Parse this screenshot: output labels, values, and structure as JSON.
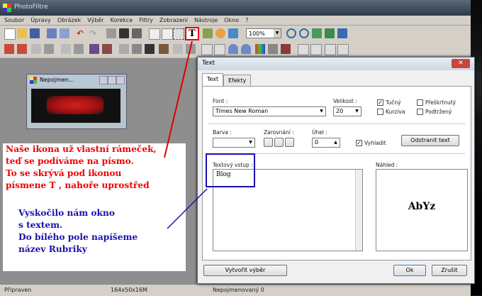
{
  "app": {
    "title": "PhotoFiltre",
    "menu": [
      "Soubor",
      "Úpravy",
      "Obrázek",
      "Výběr",
      "Korekce",
      "Filtry",
      "Zobrazení",
      "Nástroje",
      "Okno",
      "?"
    ],
    "zoom": "100%",
    "text_tool_glyph": "T"
  },
  "status": {
    "left": "Připraven",
    "size": "164x50x16M",
    "doc": "Nepojmenovaný 0"
  },
  "document": {
    "title": "Nepojmen..."
  },
  "annotation_red": [
    "Naše ikona už vlastní rámeček,",
    "teď se podíváme na písmo.",
    "To se skrývá pod ikonou",
    "písmene T , nahoře uprostřed"
  ],
  "annotation_blue": [
    "Vyskočilo nám okno",
    "s textem.",
    "Do bílého pole napíšeme",
    "název Rubriky"
  ],
  "dialog": {
    "title": "Text",
    "close": "✕",
    "tabs": [
      "Text",
      "Efekty"
    ],
    "font_label": "Font :",
    "font_value": "Times New Roman",
    "size_label": "Velikost :",
    "size_value": "20",
    "bold_label": "Tučný",
    "italic_label": "Kurzíva",
    "strike_label": "Přeškrtnutý",
    "underline_label": "Podtržený",
    "color_label": "Barva :",
    "align_label": "Zarovnání :",
    "angle_label": "Úhel :",
    "angle_value": "0",
    "smooth_label": "Vyhladit",
    "remove_text": "Odstranit text",
    "input_label": "Textový vstup :",
    "input_value": "Blog",
    "preview_label": "Náhled :",
    "preview_value": "AbYz",
    "create_selection": "Vytvořit výběr",
    "ok": "Ok",
    "cancel": "Zrušit",
    "check": "✓"
  },
  "colors": {
    "highlight_red": "#e00000",
    "annotation_blue": "#1a10b0"
  }
}
